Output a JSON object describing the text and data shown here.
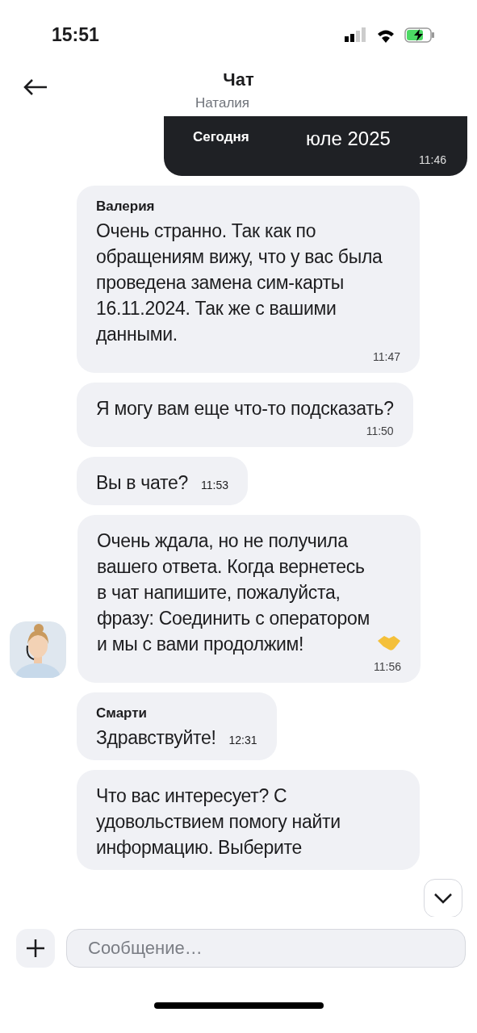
{
  "status_bar": {
    "time": "15:51"
  },
  "header": {
    "title": "Чат",
    "subtitle": "Наталия"
  },
  "date_separator": "Сегодня",
  "messages": [
    {
      "kind": "outgoing",
      "text": "юле 2025",
      "time": "11:46"
    },
    {
      "kind": "incoming",
      "sender": "Валерия",
      "text": "Очень странно. Так как по обращениям вижу, что у вас была проведена замена сим-карты 16.11.2024. Так же с вашими данными.",
      "time": "11:47"
    },
    {
      "kind": "incoming",
      "text": "Я могу вам еще что-то подсказать?",
      "time": "11:50"
    },
    {
      "kind": "short",
      "text": "Вы в чате?",
      "time": "11:53"
    },
    {
      "kind": "incoming",
      "text": "Очень ждала, но не получила вашего ответа. Когда вернетесь в чат напишите, пожалуйста, фразу: Соединить с оператором и мы с вами продолжим!",
      "time": "11:56"
    },
    {
      "kind": "short",
      "sender": "Смарти",
      "text": "Здравствуйте!",
      "time": "12:31"
    },
    {
      "kind": "incoming",
      "text": "Что вас интересует? С удовольствием помогу найти информацию. Выберите"
    }
  ],
  "composer": {
    "placeholder": "Сообщение…"
  }
}
